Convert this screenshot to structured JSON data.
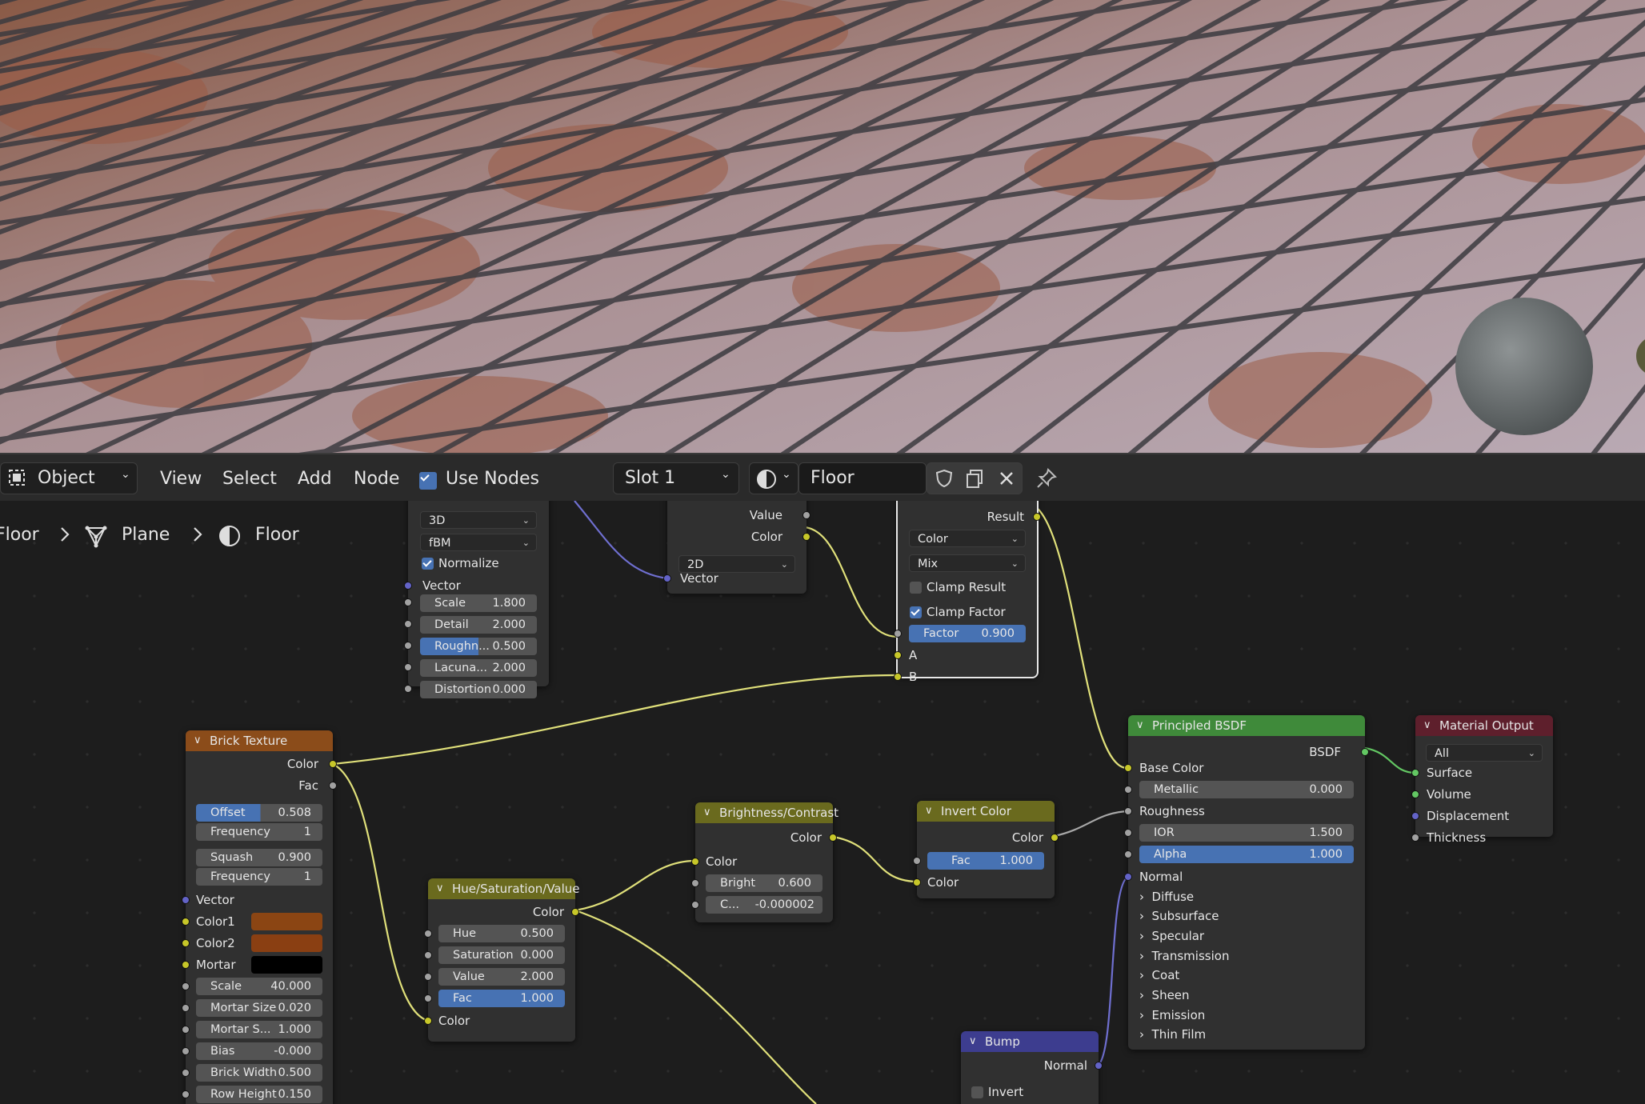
{
  "header": {
    "mode": "Object",
    "menus": [
      "View",
      "Select",
      "Add",
      "Node"
    ],
    "use_nodes_label": "Use Nodes",
    "slot": "Slot 1",
    "material_name": "Floor"
  },
  "breadcrumb": {
    "items": [
      "Floor",
      "Plane",
      "Floor"
    ]
  },
  "nodes": {
    "noise": {
      "dimensions": "3D",
      "type": "fBM",
      "normalize": "Normalize",
      "vector": "Vector",
      "fields": [
        {
          "label": "Scale",
          "value": "1.800"
        },
        {
          "label": "Detail",
          "value": "2.000"
        },
        {
          "label": "Roughn...",
          "value": "0.500"
        },
        {
          "label": "Lacuna...",
          "value": "2.000"
        },
        {
          "label": "Distortion",
          "value": "0.000"
        }
      ]
    },
    "mapping": {
      "value": "Value",
      "color": "Color",
      "dim": "2D",
      "vector": "Vector"
    },
    "mix": {
      "result": "Result",
      "data_type": "Color",
      "blend": "Mix",
      "clamp_result": "Clamp Result",
      "clamp_factor": "Clamp Factor",
      "factor_label": "Factor",
      "factor_value": "0.900",
      "a": "A",
      "b": "B"
    },
    "brick": {
      "title": "Brick Texture",
      "color_out": "Color",
      "fac_out": "Fac",
      "offset_label": "Offset",
      "offset_value": "0.508",
      "offset_frac": 0.508,
      "freq1_label": "Frequency",
      "freq1_value": "1",
      "squash_label": "Squash",
      "squash_value": "0.900",
      "freq2_label": "Frequency",
      "freq2_value": "1",
      "vector": "Vector",
      "color1": "Color1",
      "color2": "Color2",
      "mortar": "Mortar",
      "fields": [
        {
          "label": "Scale",
          "value": "40.000"
        },
        {
          "label": "Mortar Size",
          "value": "0.020"
        },
        {
          "label": "Mortar S...",
          "value": "1.000"
        },
        {
          "label": "Bias",
          "value": "-0.000"
        },
        {
          "label": "Brick Width",
          "value": "0.500"
        },
        {
          "label": "Row Height",
          "value": "0.150"
        }
      ]
    },
    "hsv": {
      "title": "Hue/Saturation/Value",
      "color_out": "Color",
      "fields": [
        {
          "label": "Hue",
          "value": "0.500"
        },
        {
          "label": "Saturation",
          "value": "0.000"
        },
        {
          "label": "Value",
          "value": "2.000"
        }
      ],
      "fac_label": "Fac",
      "fac_value": "1.000",
      "color_in": "Color"
    },
    "bc": {
      "title": "Brightness/Contrast",
      "color_out": "Color",
      "color_in": "Color",
      "bright_label": "Bright",
      "bright_value": "0.600",
      "contrast_label": "C...",
      "contrast_value": "-0.000002"
    },
    "invert": {
      "title": "Invert Color",
      "color_out": "Color",
      "fac_label": "Fac",
      "fac_value": "1.000",
      "color_in": "Color"
    },
    "bump": {
      "title": "Bump",
      "normal": "Normal",
      "invert": "Invert"
    },
    "bsdf": {
      "title": "Principled BSDF",
      "bsdf_out": "BSDF",
      "base_color": "Base Color",
      "metallic_label": "Metallic",
      "metallic_value": "0.000",
      "roughness": "Roughness",
      "ior_label": "IOR",
      "ior_value": "1.500",
      "alpha_label": "Alpha",
      "alpha_value": "1.000",
      "normal": "Normal",
      "panels": [
        "Diffuse",
        "Subsurface",
        "Specular",
        "Transmission",
        "Coat",
        "Sheen",
        "Emission",
        "Thin Film"
      ]
    },
    "output": {
      "title": "Material Output",
      "target": "All",
      "surface": "Surface",
      "volume": "Volume",
      "displacement": "Displacement",
      "thickness": "Thickness"
    }
  },
  "colors": {
    "texture_header": "#8b4c1a",
    "color_header": "#6a6a1e",
    "shader_header": "#3f8a3a",
    "output_header": "#5e1f2c",
    "vector_header": "#3d3d8f",
    "accent": "#4772b3",
    "brick_color1": "#8b4513",
    "brick_color2": "#8a3f12",
    "mortar_color": "#000000"
  }
}
